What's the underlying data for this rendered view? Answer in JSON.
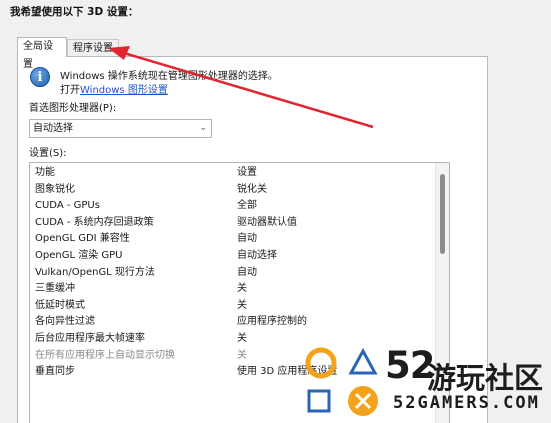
{
  "heading": "我希望使用以下 3D 设置：",
  "tabs": {
    "global": "全局设置",
    "program": "程序设置"
  },
  "info": {
    "line1": "Windows 操作系统现在管理图形处理器的选择。",
    "line2_prefix": "打开",
    "line2_link": "Windows 图形设置"
  },
  "preferred_processor": {
    "label": "首选图形处理器(P):",
    "value": "自动选择"
  },
  "settings_label": "设置(S):",
  "table": {
    "headers": [
      "功能",
      "设置"
    ],
    "rows": [
      [
        "图象锐化",
        "锐化关"
      ],
      [
        "CUDA - GPUs",
        "全部"
      ],
      [
        "CUDA - 系统内存回退政策",
        "驱动器默认值"
      ],
      [
        "OpenGL GDI 兼容性",
        "自动"
      ],
      [
        "OpenGL 渲染 GPU",
        "自动选择"
      ],
      [
        "Vulkan/OpenGL 现行方法",
        "自动"
      ],
      [
        "三重缓冲",
        "关"
      ],
      [
        "低延时模式",
        "关"
      ],
      [
        "各向异性过滤",
        "应用程序控制的"
      ],
      [
        "后台应用程序最大帧速率",
        "关"
      ],
      [
        "在所有应用程序上自动显示切换",
        "关"
      ],
      [
        "垂直同步",
        "使用 3D 应用程序设置"
      ]
    ],
    "dim_rows": [
      10
    ]
  },
  "watermark": {
    "brand": "52",
    "cn": "游玩社区",
    "domain": "52GAMERS.COM"
  },
  "colors": {
    "arrow": "#e0252f",
    "wm_orange": "#f5a21b",
    "wm_blue": "#2a64b4",
    "link": "#1a55c8"
  }
}
